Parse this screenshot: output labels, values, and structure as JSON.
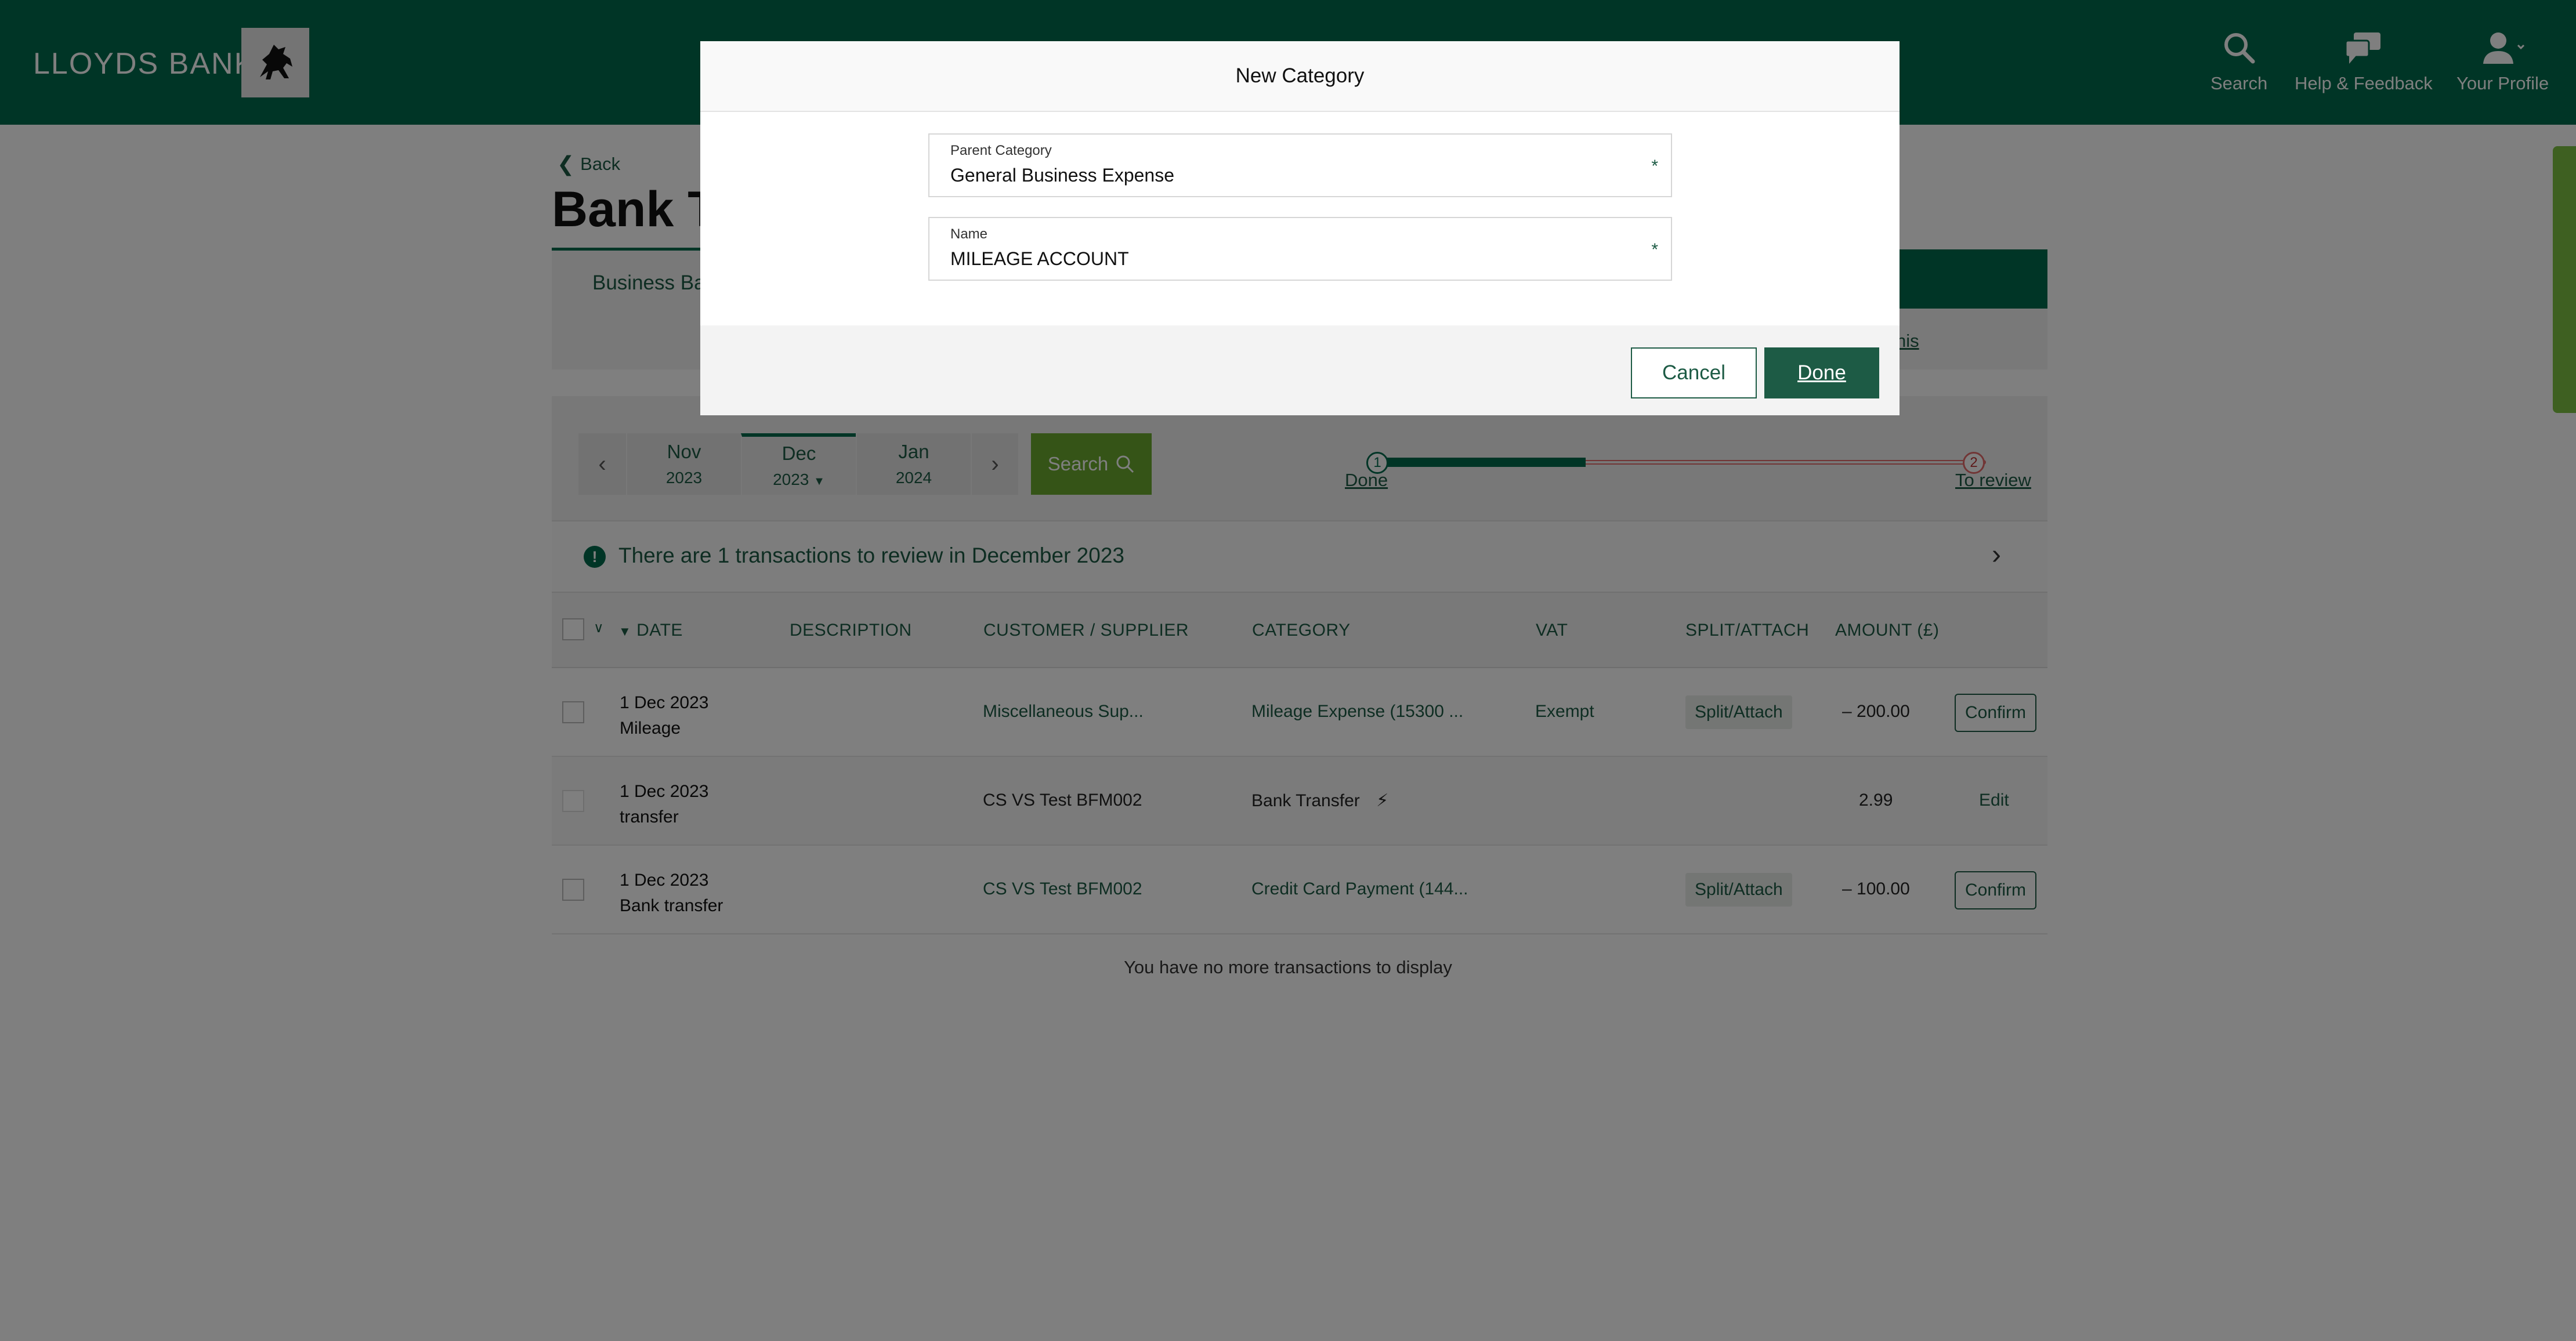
{
  "header": {
    "brand": "LLOYDS BANK",
    "nav": [
      {
        "label": "Search",
        "icon": "search-icon"
      },
      {
        "label": "Help & Feedback",
        "icon": "chat-icon"
      },
      {
        "label": "Your Profile",
        "icon": "user-icon"
      }
    ]
  },
  "page": {
    "back_label": "Back",
    "title_visible": "Bank Tr",
    "subnav_label": "Business Ba",
    "band_link": "his"
  },
  "filters": {
    "months": [
      {
        "month": "Nov",
        "year": "2023"
      },
      {
        "month": "Dec",
        "year": "2023"
      },
      {
        "month": "Jan",
        "year": "2024"
      }
    ],
    "selected_month": "Dec",
    "search_label": "Search",
    "progress": {
      "done_label": "Done",
      "review_label": "To review",
      "step1": "1",
      "step2": "2",
      "done_fraction": 0.33
    }
  },
  "alert": {
    "text": "There are 1 transactions to review in December 2023"
  },
  "table": {
    "columns": {
      "date": "DATE",
      "description": "DESCRIPTION",
      "customer": "CUSTOMER / SUPPLIER",
      "category": "CATEGORY",
      "vat": "VAT",
      "split": "SPLIT/ATTACH",
      "amount": "AMOUNT (£)"
    },
    "rows": [
      {
        "date": "1 Dec 2023",
        "desc": "Mileage",
        "customer": "Miscellaneous Sup...",
        "category": "Mileage Expense (15300 ...",
        "vat": "Exempt",
        "split": "Split/Attach",
        "amount": "– 200.00",
        "action": "Confirm"
      },
      {
        "date": "1 Dec 2023",
        "desc": "transfer",
        "customer": "CS VS Test BFM002",
        "category": "Bank Transfer",
        "vat": "",
        "split": "",
        "amount": "2.99",
        "action": "Edit"
      },
      {
        "date": "1 Dec 2023",
        "desc": "Bank transfer",
        "customer": "CS VS Test BFM002",
        "category": "Credit Card Payment (144...",
        "vat": "",
        "split": "Split/Attach",
        "amount": "– 100.00",
        "action": "Confirm"
      }
    ],
    "footer": "You have no more transactions to display"
  },
  "modal": {
    "title": "New Category",
    "parent_label": "Parent Category",
    "parent_value": "General Business Expense",
    "name_label": "Name",
    "name_value": "MILEAGE ACCOUNT",
    "required_mark": "*",
    "cancel_label": "Cancel",
    "done_label": "Done"
  },
  "colors": {
    "brand_green": "#006a4d",
    "dark_green": "#1d5b45",
    "search_green": "#6aa82e",
    "review_red": "#e26b6b"
  }
}
